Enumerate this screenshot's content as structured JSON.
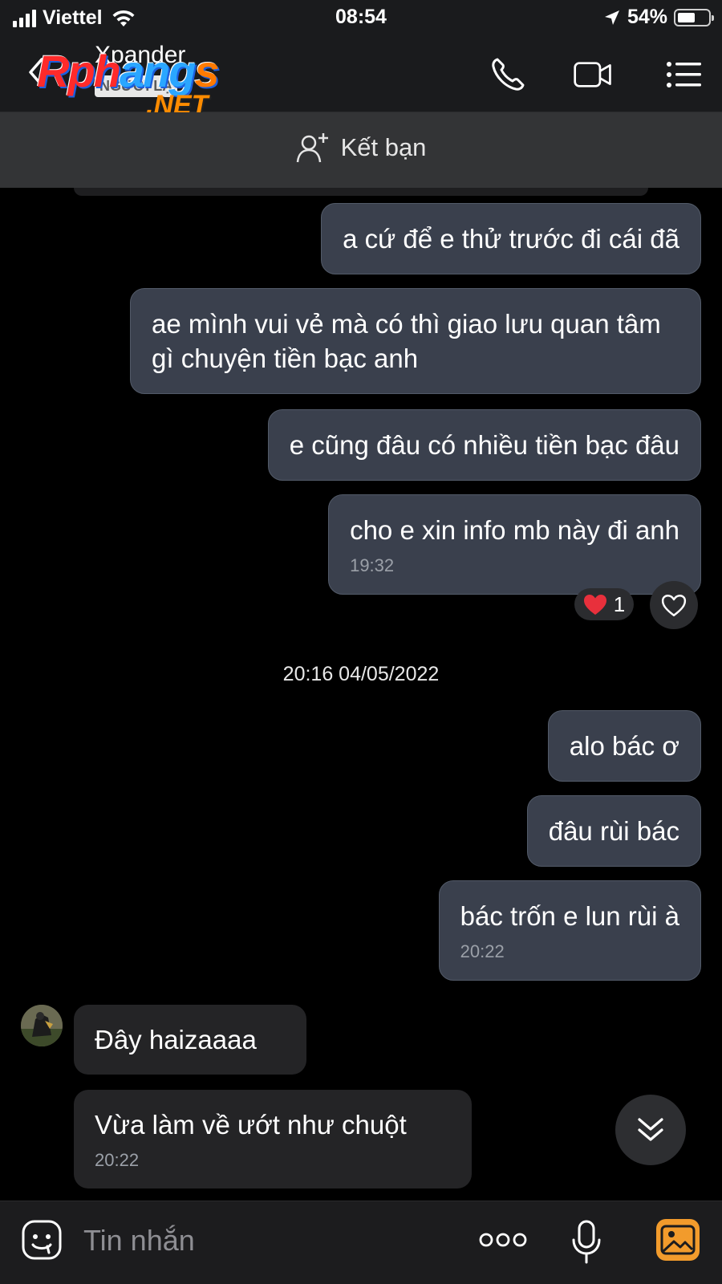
{
  "status_bar": {
    "carrier": "Viettel",
    "time": "08:54",
    "battery_percent": "54%",
    "battery_level": 0.54
  },
  "header": {
    "contact_name": "Xpander",
    "contact_tag": "NGƯỜI LẠ",
    "watermark": {
      "part1": "Rph",
      "part2": "ang",
      "part3": "s",
      "suffix": ".NET"
    },
    "icons": [
      "back-icon",
      "phone-icon",
      "video-icon",
      "menu-icon"
    ]
  },
  "add_friend": {
    "label": "Kết bạn",
    "icon": "add-user-icon"
  },
  "messages": [
    {
      "dir": "out",
      "text": "a cứ để e thử trước đi cái đã"
    },
    {
      "dir": "out",
      "text": "ae mình vui vẻ mà có thì giao lưu quan tâm gì chuyện tiền bạc anh"
    },
    {
      "dir": "out",
      "text": "e cũng đâu có nhiều tiền bạc đâu"
    },
    {
      "dir": "out",
      "text": "cho e xin info mb này đi anh",
      "time": "19:32"
    },
    {
      "dir": "out",
      "text": "alo bác ơ"
    },
    {
      "dir": "out",
      "text": "đâu rùi bác"
    },
    {
      "dir": "out",
      "text": "bác trốn e lun rùi à",
      "time": "20:22"
    },
    {
      "dir": "in",
      "text": "Đây haizaaaa"
    },
    {
      "dir": "in",
      "text": "Vừa làm về ướt như chuột",
      "time": "20:22"
    }
  ],
  "reaction": {
    "emoji": "heart",
    "count": "1"
  },
  "date_separator": "20:16 04/05/2022",
  "composer": {
    "placeholder": "Tin nhắn"
  },
  "colors": {
    "outgoing_bubble": "#3a404d",
    "incoming_bubble": "#242426",
    "header_bg": "#1a1b1d",
    "image_button": "#f29b2c",
    "heart": "#e8303c"
  }
}
